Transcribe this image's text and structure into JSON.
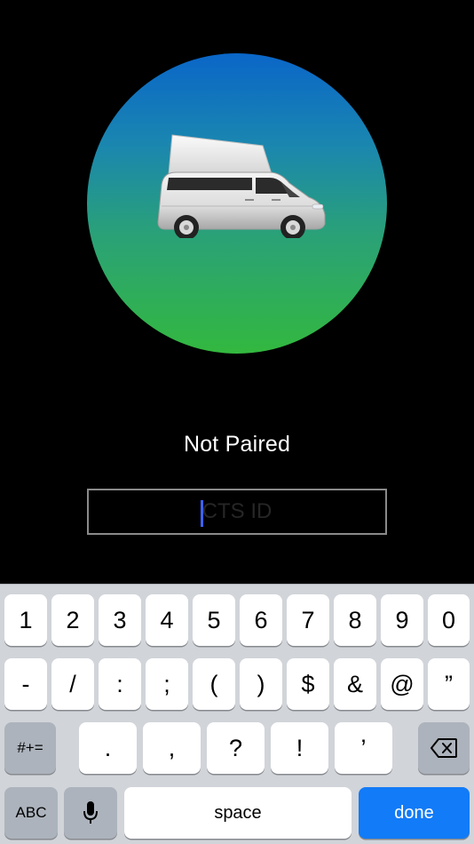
{
  "status": {
    "text": "Not Paired"
  },
  "id_field": {
    "placeholder": "CTS ID",
    "value": ""
  },
  "keyboard": {
    "row1": [
      "1",
      "2",
      "3",
      "4",
      "5",
      "6",
      "7",
      "8",
      "9",
      "0"
    ],
    "row2": [
      "-",
      "/",
      ":",
      ";",
      "(",
      ")",
      "$",
      "&",
      "@",
      "”"
    ],
    "row3_left": "#+=",
    "row3_keys": [
      ".",
      ",",
      "?",
      "!",
      "’"
    ],
    "row4": {
      "abc": "ABC",
      "space": "space",
      "done": "done"
    }
  },
  "colors": {
    "background": "#000000",
    "hero_gradient_top": "#0a66c8",
    "hero_gradient_bottom": "#33b83f",
    "keyboard_bg": "#d1d4d9",
    "done_key": "#127bf7",
    "caret": "#3e62ff"
  },
  "icons": {
    "hero": "camper-van-icon",
    "dictation": "microphone-icon",
    "delete": "backspace-icon"
  }
}
